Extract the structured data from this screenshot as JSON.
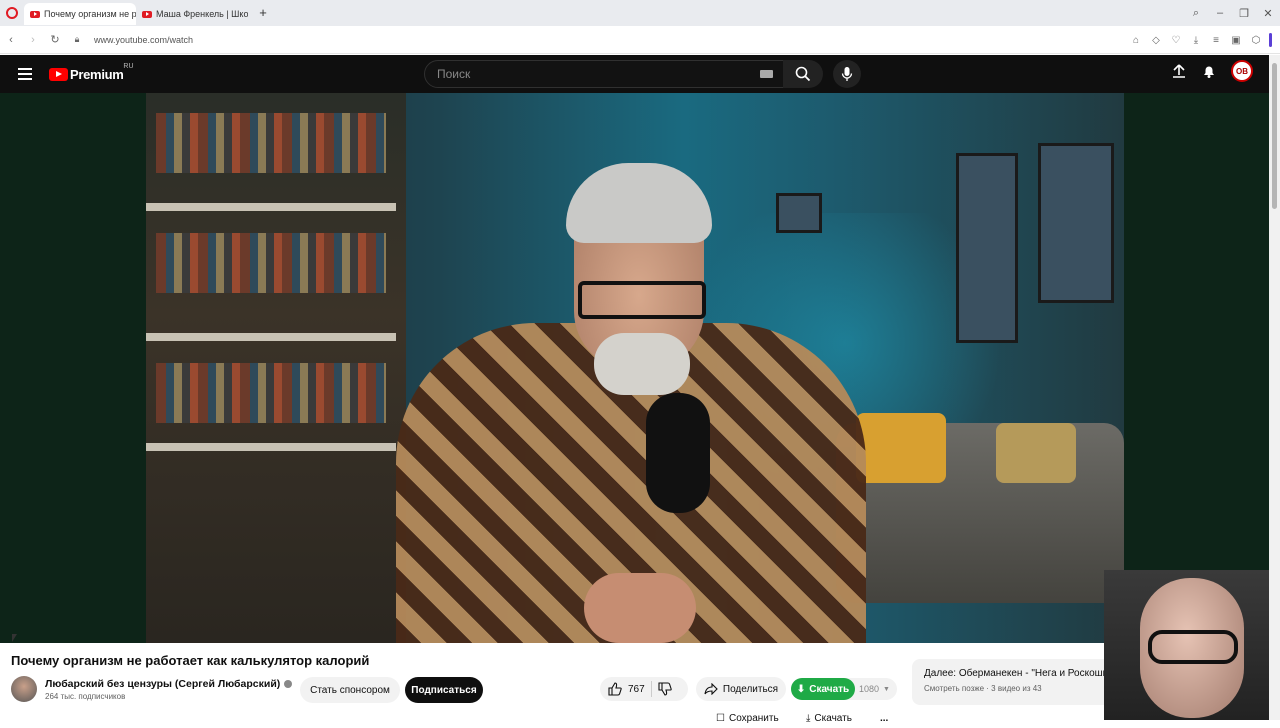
{
  "browser": {
    "tabs": [
      {
        "label": "Почему организм не ра",
        "active": true
      },
      {
        "label": "Маша Френкель | Школа",
        "active": false
      }
    ],
    "new_tab": "+",
    "url": "www.youtube.com/watch"
  },
  "youtube": {
    "logo_text": "Premium",
    "region": "RU",
    "search_placeholder": "Поиск",
    "avatar_initials": "ОВ"
  },
  "video": {
    "title": "Почему организм не работает как калькулятор калорий",
    "channel_name": "Любарский без цензуры (Сергей Любарский)",
    "subscribers": "264 тыс. подписчиков",
    "sponsor_label": "Стать спонсором",
    "subscribe_label": "Подписаться",
    "likes": "767",
    "share_label": "Поделиться",
    "download_label": "Скачать",
    "quality": "1080",
    "save_label": "Сохранить",
    "download2_label": "Скачать",
    "more_label": "..."
  },
  "up_next": {
    "title": "Далее: Оберманекен - \"Нега и Роскошь\" \\\\ А",
    "subtitle": "Смотреть позже · 3 видео из 43"
  },
  "colors": {
    "youtube_red": "#ff0000",
    "download_green": "#1faa46",
    "header_bg": "#0f0f0f"
  }
}
